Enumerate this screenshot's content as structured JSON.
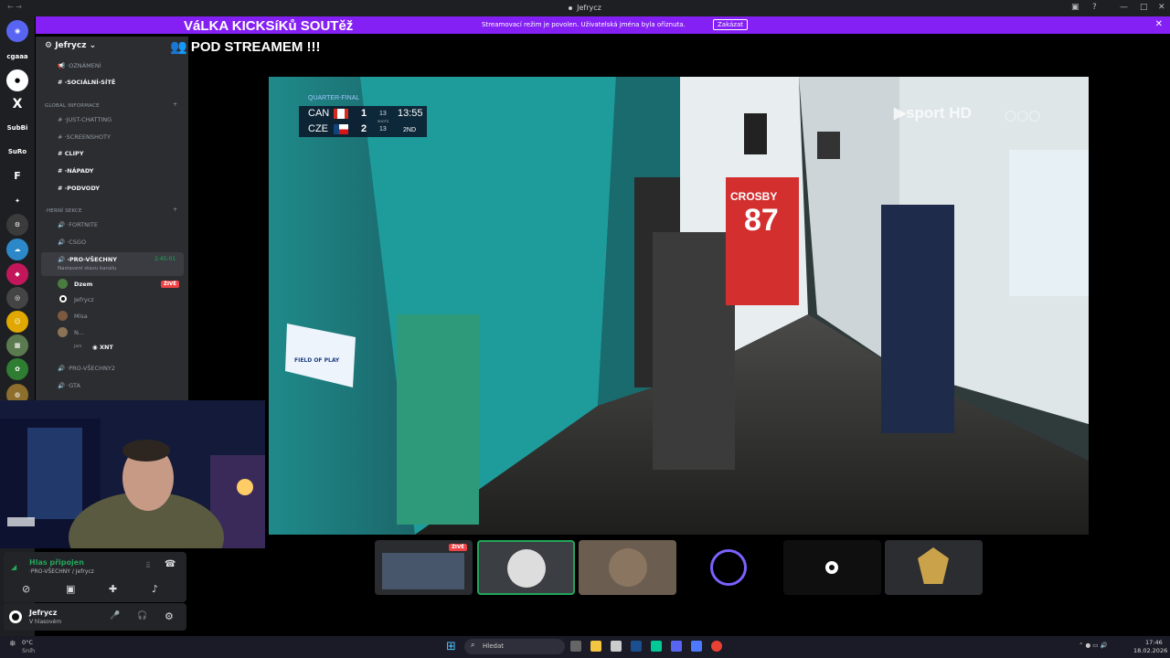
{
  "window": {
    "title": "Jefrycz"
  },
  "banner": {
    "title": "VáLKA KICKSíKů SOUTěž",
    "subtitle": "POD STREAMEM !!!",
    "message": "Streamovací režim je povolen. Uživatelská jména byla oříznuta.",
    "button": "Zakázat"
  },
  "servers": [
    "cgaaa",
    "X",
    "SubBi",
    "SuRo",
    "F"
  ],
  "server_header": {
    "name": "Jefrycz"
  },
  "channels": {
    "oznameni": "·OZNÁMENÍ",
    "socialni": "·SOCIÁLNÍ-SÍTĚ",
    "cat_info": "GLOBAL INFORMACE",
    "just": "·JUST-CHATTING",
    "screens": "·SCREENSHOTY",
    "clipy": "CLIPY",
    "napady": "·NÁPADY",
    "podvody": "·PODVODY",
    "cat_herni": "·HERNÍ SEKCE",
    "fortnite": "·FORTNITE",
    "csgo": "·CSGO",
    "pro": "·PRO-VŠECHNY",
    "timer": "2:45:01",
    "status": "Nastavení stavu kanálu",
    "pro2": "·PRO-VŠECHNY2",
    "gta": "·GTA"
  },
  "voice_users": [
    {
      "name": "Dzem",
      "live": "ŽIVĚ"
    },
    {
      "name": "Jefrycz"
    },
    {
      "name": "Misa"
    },
    {
      "name": "N..."
    },
    {
      "name": "XNT",
      "prefix": "Jam"
    }
  ],
  "scoreboard": {
    "stage": "QUARTER-FINAL",
    "team1": "CAN",
    "score1": "1",
    "shots1": "13",
    "team2": "CZE",
    "score2": "2",
    "shots2": "13",
    "clock": "13:55",
    "period": "2ND",
    "shots_label": "SHOTS",
    "channel": "sport HD"
  },
  "video_text": {
    "jersey_name": "CROSBY",
    "jersey_num": "87",
    "sign": "FIELD OF PLAY"
  },
  "voice_panel": {
    "status": "Hlas připojen",
    "channel": "·PRO-VŠECHNY / Jefrycz"
  },
  "user_panel": {
    "name": "Jefrycz",
    "status": "V hlasovém"
  },
  "tiles": {
    "live": "ŽIVĚ"
  },
  "taskbar": {
    "weather_temp": "0°C",
    "weather_desc": "Sníh",
    "search": "Hledat",
    "time": "17:46",
    "date": "18.02.2026"
  },
  "colors": {
    "accent": "#8520f4",
    "live": "#ed4245",
    "connected": "#23a55a"
  }
}
